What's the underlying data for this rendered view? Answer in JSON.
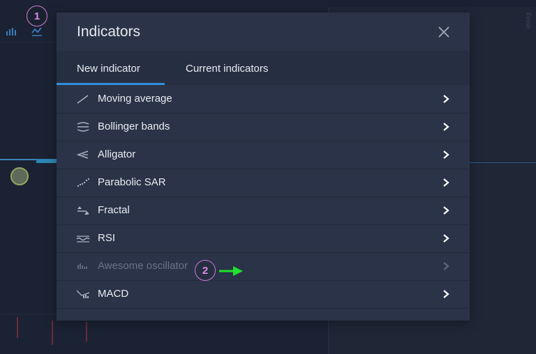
{
  "background": {
    "side_label": "Finish"
  },
  "markers": {
    "one": "1",
    "two": "2"
  },
  "modal": {
    "title": "Indicators",
    "tabs": [
      {
        "label": "New indicator",
        "active": true
      },
      {
        "label": "Current indicators",
        "active": false
      }
    ],
    "items": [
      {
        "label": "Moving average",
        "icon": "moving-average-icon",
        "enabled": true
      },
      {
        "label": "Bollinger bands",
        "icon": "bollinger-bands-icon",
        "enabled": true
      },
      {
        "label": "Alligator",
        "icon": "alligator-icon",
        "enabled": true
      },
      {
        "label": "Parabolic SAR",
        "icon": "parabolic-sar-icon",
        "enabled": true
      },
      {
        "label": "Fractal",
        "icon": "fractal-icon",
        "enabled": true
      },
      {
        "label": "RSI",
        "icon": "rsi-icon",
        "enabled": true
      },
      {
        "label": "Awesome oscillator",
        "icon": "awesome-oscillator-icon",
        "enabled": false
      },
      {
        "label": "MACD",
        "icon": "macd-icon",
        "enabled": true
      }
    ]
  },
  "colors": {
    "accent": "#2f8fdc",
    "marker": "#d27ad6",
    "arrow": "#1ee32a",
    "modal_bg": "#2a3347"
  }
}
